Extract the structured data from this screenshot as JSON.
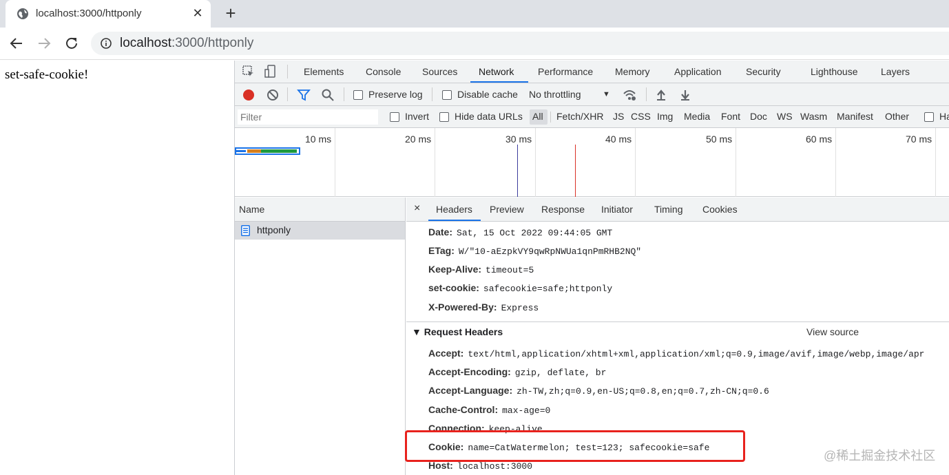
{
  "browser": {
    "tab_title": "localhost:3000/httponly",
    "url_host": "localhost",
    "url_rest": ":3000/httponly"
  },
  "page": {
    "text": "set-safe-cookie!"
  },
  "devtools": {
    "tabs": [
      "Elements",
      "Console",
      "Sources",
      "Network",
      "Performance",
      "Memory",
      "Application",
      "Security",
      "Lighthouse",
      "Layers"
    ],
    "active_tab": "Network",
    "network_toolbar": {
      "preserve_log": "Preserve log",
      "disable_cache": "Disable cache",
      "throttling": "No throttling"
    },
    "filter": {
      "placeholder": "Filter",
      "invert": "Invert",
      "hide_data_urls": "Hide data URLs",
      "types": [
        "All",
        "Fetch/XHR",
        "JS",
        "CSS",
        "Img",
        "Media",
        "Font",
        "Doc",
        "WS",
        "Wasm",
        "Manifest",
        "Other",
        "Ha"
      ]
    },
    "timeline_labels": [
      "10 ms",
      "20 ms",
      "30 ms",
      "40 ms",
      "50 ms",
      "60 ms",
      "70 ms"
    ],
    "name_column": {
      "header": "Name",
      "rows": [
        "httponly"
      ]
    },
    "detail_tabs": [
      "Headers",
      "Preview",
      "Response",
      "Initiator",
      "Timing",
      "Cookies"
    ],
    "close_label": "×",
    "response_headers": [
      {
        "key": "Date:",
        "value": "Sat, 15 Oct 2022 09:44:05 GMT"
      },
      {
        "key": "ETag:",
        "value": "W/\"10-aEzpkVY9qwRpNWUa1qnPmRHB2NQ\""
      },
      {
        "key": "Keep-Alive:",
        "value": "timeout=5"
      },
      {
        "key": "set-cookie:",
        "value": "safecookie=safe;httponly"
      },
      {
        "key": "X-Powered-By:",
        "value": "Express"
      }
    ],
    "request_headers_title": "▼ Request Headers",
    "view_source": "View source",
    "request_headers": [
      {
        "key": "Accept:",
        "value": "text/html,application/xhtml+xml,application/xml;q=0.9,image/avif,image/webp,image/apr"
      },
      {
        "key": "Accept-Encoding:",
        "value": "gzip, deflate, br"
      },
      {
        "key": "Accept-Language:",
        "value": "zh-TW,zh;q=0.9,en-US;q=0.8,en;q=0.7,zh-CN;q=0.6"
      },
      {
        "key": "Cache-Control:",
        "value": "max-age=0"
      },
      {
        "key": "Connection:",
        "value": "keep-alive"
      },
      {
        "key": "Cookie:",
        "value": "name=CatWatermelon; test=123; safecookie=safe"
      },
      {
        "key": "Host:",
        "value": "localhost:3000"
      }
    ]
  },
  "watermark": "@稀土掘金技术社区",
  "colors": {
    "accent": "#1a73e8",
    "record": "#d93025",
    "highlight": "#e8221d"
  }
}
